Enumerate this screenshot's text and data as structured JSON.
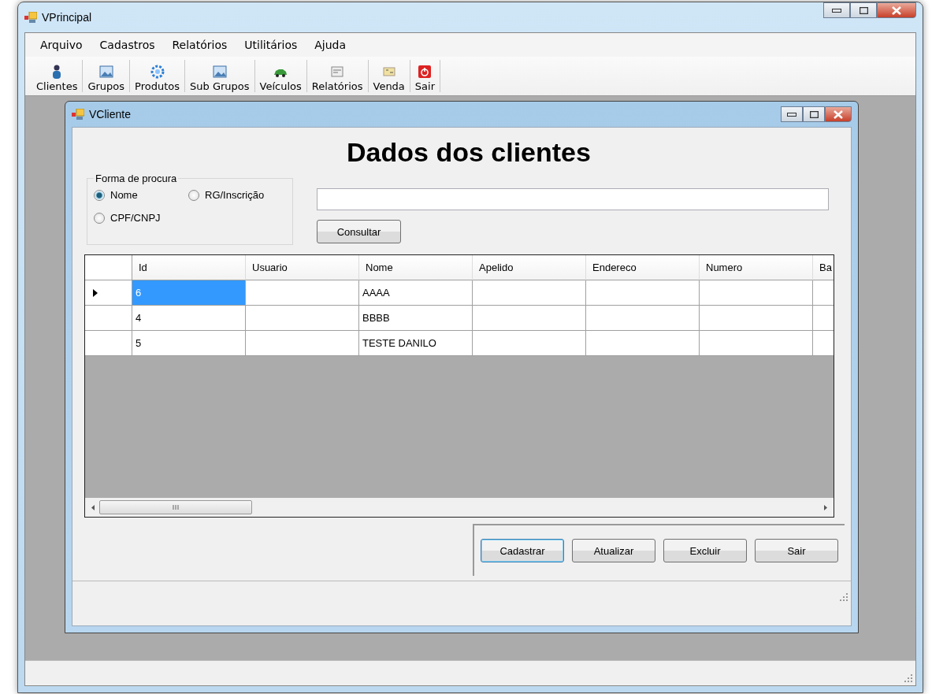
{
  "window": {
    "title": "VPrincipal"
  },
  "menu": [
    "Arquivo",
    "Cadastros",
    "Relatórios",
    "Utilitários",
    "Ajuda"
  ],
  "toolbar": [
    {
      "label": "Clientes",
      "kind": "person"
    },
    {
      "label": "Grupos",
      "kind": "picture"
    },
    {
      "label": "Produtos",
      "kind": "gear"
    },
    {
      "label": "Sub Grupos",
      "kind": "picture"
    },
    {
      "label": "Veículos",
      "kind": "car"
    },
    {
      "label": "Relatórios",
      "kind": "report"
    },
    {
      "label": "Venda",
      "kind": "sale"
    },
    {
      "label": "Sair",
      "kind": "exit"
    }
  ],
  "child": {
    "title": "VCliente",
    "heading": "Dados dos clientes",
    "search_group": {
      "title": "Forma de procura",
      "options": [
        {
          "label": "Nome",
          "selected": true
        },
        {
          "label": "RG/Inscrição",
          "selected": false
        },
        {
          "label": "CPF/CNPJ",
          "selected": false
        }
      ]
    },
    "search_button": "Consultar",
    "table": {
      "columns": [
        "Id",
        "Usuario",
        "Nome",
        "Apelido",
        "Endereco",
        "Numero",
        "Ba"
      ],
      "rows": [
        {
          "id": "6",
          "nome": "AAAA",
          "current": true
        },
        {
          "id": "4",
          "nome": "BBBB",
          "current": false
        },
        {
          "id": "5",
          "nome": "TESTE DANILO",
          "current": false
        }
      ]
    },
    "buttons": [
      {
        "label": "Cadastrar",
        "focused": true
      },
      {
        "label": "Atualizar",
        "focused": false
      },
      {
        "label": "Excluir",
        "focused": false
      },
      {
        "label": "Sair",
        "focused": false
      }
    ]
  }
}
